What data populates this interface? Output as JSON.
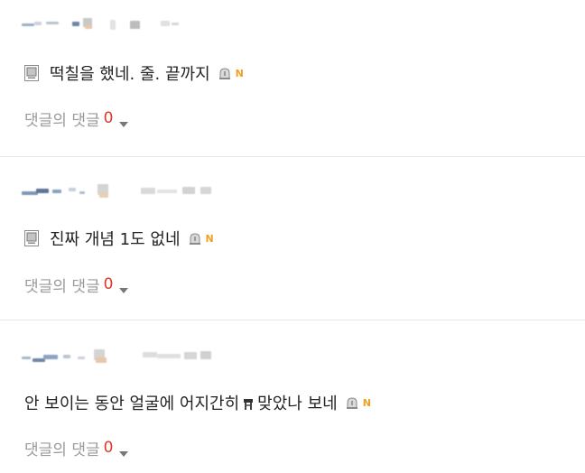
{
  "comments": [
    {
      "text": "떡칠을 했네. 줄. 끝까지",
      "has_doc_icon": true,
      "badge": "N",
      "reply_label": "댓글의 댓글",
      "reply_count": "0"
    },
    {
      "text": "진짜 개념 1도 없네",
      "has_doc_icon": true,
      "badge": "N",
      "reply_label": "댓글의 댓글",
      "reply_count": "0"
    },
    {
      "text_before_glyph": "안 보이는 동안 얼굴에 어지간히",
      "text_after_glyph": "맞았나 보네",
      "has_doc_icon": false,
      "badge": "N",
      "reply_label": "댓글의 댓글",
      "reply_count": "0"
    }
  ],
  "icons": {
    "doc": "document-icon",
    "flag": "report-siren-icon",
    "caret": "chevron-down-icon"
  },
  "colors": {
    "reply_label": "#9a9a9a",
    "reply_count": "#d93a2b",
    "badge": "#f0a020",
    "divider": "#e6e6e6"
  }
}
